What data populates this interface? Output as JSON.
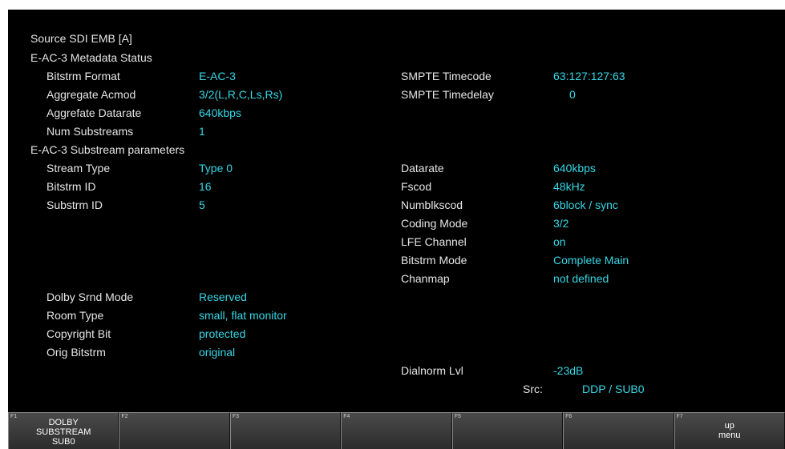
{
  "header": {
    "source": "Source SDI EMB [A]",
    "section_metadata": "E-AC-3 Metadata Status",
    "section_substream": "E-AC-3 Substream parameters"
  },
  "metadata": {
    "bitstrm_format": {
      "label": "Bitstrm Format",
      "value": "E-AC-3"
    },
    "aggregate_acmod": {
      "label": "Aggregate Acmod",
      "value": "3/2(L,R,C,Ls,Rs)"
    },
    "aggregate_datarate": {
      "label": "Aggrefate Datarate",
      "value": "640kbps"
    },
    "num_substreams": {
      "label": "Num Substreams",
      "value": "1"
    },
    "smpte_timecode": {
      "label": "SMPTE Timecode",
      "value": "63:127:127:63"
    },
    "smpte_timedelay": {
      "label": "SMPTE Timedelay",
      "value": "0"
    }
  },
  "substream": {
    "stream_type": {
      "label": "Stream Type",
      "value": "Type 0"
    },
    "bitstrm_id": {
      "label": "Bitstrm ID",
      "value": "16"
    },
    "substrm_id": {
      "label": "Substrm ID",
      "value": "5"
    },
    "datarate": {
      "label": "Datarate",
      "value": "640kbps"
    },
    "fscod": {
      "label": "Fscod",
      "value": "48kHz"
    },
    "numblkscod": {
      "label": "Numblkscod",
      "value": "6block / sync"
    },
    "coding_mode": {
      "label": "Coding Mode",
      "value": "3/2"
    },
    "lfe_channel": {
      "label": "LFE Channel",
      "value": "on"
    },
    "bitstrm_mode": {
      "label": "Bitstrm Mode",
      "value": "Complete Main"
    },
    "chanmap": {
      "label": "Chanmap",
      "value": "not defined"
    },
    "dolby_srnd_mode": {
      "label": "Dolby Srnd Mode",
      "value": "Reserved"
    },
    "room_type": {
      "label": "Room Type",
      "value": "small, flat monitor"
    },
    "copyright_bit": {
      "label": "Copyright Bit",
      "value": "protected"
    },
    "orig_bitstrm": {
      "label": "Orig Bitstrm",
      "value": "original"
    },
    "dialnorm_lvl": {
      "label": "Dialnorm Lvl",
      "value": "-23dB"
    }
  },
  "src": {
    "label": "Src:",
    "value": "DDP / SUB0"
  },
  "colors": {
    "background": "#000000",
    "label_text": "#e6e6e6",
    "value_text": "#36d7e6"
  },
  "function_keys": [
    {
      "num": "F1",
      "label": "DOLBY\nSUBSTREAM\nSUB0"
    },
    {
      "num": "F2",
      "label": ""
    },
    {
      "num": "F3",
      "label": ""
    },
    {
      "num": "F4",
      "label": ""
    },
    {
      "num": "F5",
      "label": ""
    },
    {
      "num": "F6",
      "label": ""
    },
    {
      "num": "F7",
      "label": "up\nmenu"
    }
  ]
}
